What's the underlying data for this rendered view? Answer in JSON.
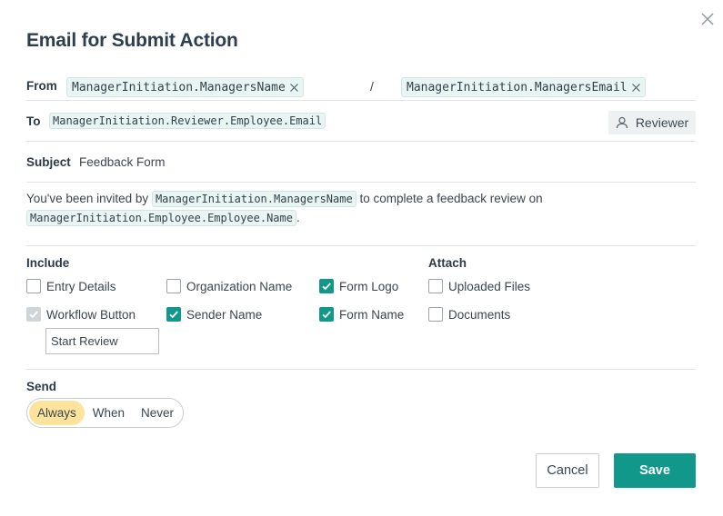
{
  "dialog": {
    "title": "Email for Submit Action",
    "close_icon": "close-icon"
  },
  "from": {
    "label": "From",
    "name_token": "ManagerInitiation.ManagersName",
    "separator": "/",
    "email_token": "ManagerInitiation.ManagersEmail"
  },
  "to": {
    "label": "To",
    "token": "ManagerInitiation.Reviewer.Employee.Email",
    "reviewer_button": "Reviewer"
  },
  "subject": {
    "label": "Subject",
    "value": "Feedback Form"
  },
  "message": {
    "part1": "You've been invited by",
    "token1": "ManagerInitiation.ManagersName",
    "part2": "to complete a feedback review on",
    "token2": "ManagerInitiation.Employee.Employee.Name",
    "part3": "."
  },
  "include": {
    "title": "Include",
    "items": [
      {
        "label": "Entry Details",
        "checked": false
      },
      {
        "label": "Organization Name",
        "checked": false
      },
      {
        "label": "Form Logo",
        "checked": true
      },
      {
        "label": "Workflow Button",
        "checked": true,
        "disabled": true
      },
      {
        "label": "Sender Name",
        "checked": true
      },
      {
        "label": "Form Name",
        "checked": true
      }
    ],
    "button_text": "Start Review"
  },
  "attach": {
    "title": "Attach",
    "items": [
      {
        "label": "Uploaded Files",
        "checked": false
      },
      {
        "label": "Documents",
        "checked": false
      }
    ]
  },
  "send": {
    "title": "Send",
    "options": [
      "Always",
      "When",
      "Never"
    ],
    "selected": "Always"
  },
  "actions": {
    "cancel": "Cancel",
    "save": "Save"
  },
  "colors": {
    "accent": "#11988a",
    "chip_bg": "#e8f5f3",
    "selected_segment": "#fde39b"
  }
}
